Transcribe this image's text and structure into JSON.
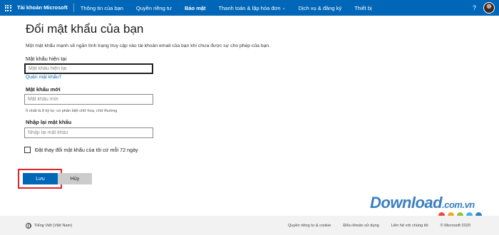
{
  "topbar": {
    "brand": "Tài khoản Microsoft",
    "nav": [
      {
        "label": "Thông tin của bạn",
        "chevron": false
      },
      {
        "label": "Quyền riêng tư",
        "chevron": false
      },
      {
        "label": "Bảo mật",
        "chevron": false
      },
      {
        "label": "Thanh toán & lập hóa đơn",
        "chevron": true
      },
      {
        "label": "Dịch vụ & đăng ký",
        "chevron": false
      },
      {
        "label": "Thiết bị",
        "chevron": false
      }
    ],
    "active": "Bảo mật",
    "help": "?",
    "chevron_glyph": "⌄"
  },
  "form": {
    "title": "Đổi mật khẩu của bạn",
    "intro": "Một mật khẩu mạnh sẽ ngăn tình trạng truy cập vào tài khoản email của bạn khi chưa được sự cho phép của bạn.",
    "current_label": "Mật khẩu hiện tại",
    "current_placeholder": "Mật khẩu hiện tại",
    "forgot_link": "Quên mật khẩu?",
    "new_label": "Mật khẩu mới",
    "new_placeholder": "Mật khẩu mới",
    "hint": "Ít nhất là 8 ký tự; có phân biệt chữ hoa, chữ thường",
    "reenter_label": "Nhập lại mật khẩu",
    "reenter_placeholder": "Nhập lại mật khẩu",
    "checkbox_label": "Đặt thay đổi mật khẩu của tôi cứ mỗi 72 ngày",
    "checkbox_checked": false,
    "save_label": "Lưu",
    "cancel_label": "Hủy"
  },
  "watermark": {
    "text": "Download",
    "suffix": ".com.vn",
    "dot_colors": [
      "#e94b3c",
      "#f3a533",
      "#8cc63f",
      "#46b4e6",
      "#3b7dc4"
    ]
  },
  "footer": {
    "language": "Tiếng Việt (Việt Nam)",
    "links": [
      "Quyền riêng tư & cookie",
      "Điều khoản sử dụng",
      "Liên hệ với chúng tôi"
    ],
    "copyright": "© Microsoft 2020"
  },
  "colors": {
    "brand_blue": "#0067b8",
    "highlight_red": "#e8202a"
  }
}
